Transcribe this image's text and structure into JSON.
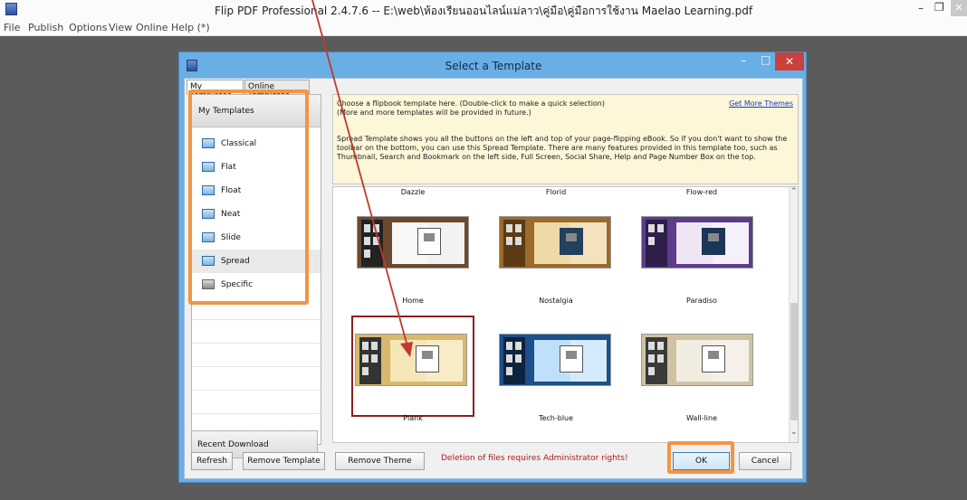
{
  "app": {
    "title": "Flip PDF Professional 2.4.7.6 -- E:\\web\\ห้องเรียนออนไลน์แม่ลาว\\คู่มือ\\คู่มือการใช้งาน Maelao Learning.pdf",
    "min": "–",
    "max": "❐",
    "close": "✕"
  },
  "menu": [
    "File",
    "Publish",
    "Options",
    "View",
    "Online",
    "Help (*)"
  ],
  "dialog": {
    "title": "Select a Template",
    "min": "–",
    "max": "□",
    "close": "✕",
    "tabs": [
      "My Templates",
      "Online Templates"
    ],
    "left_header": "My Templates",
    "templates": [
      {
        "label": "Classical",
        "icon": "template-blue-icon"
      },
      {
        "label": "Flat",
        "icon": "template-blue-icon"
      },
      {
        "label": "Float",
        "icon": "template-blue-icon"
      },
      {
        "label": "Neat",
        "icon": "template-blue-icon"
      },
      {
        "label": "Slide",
        "icon": "template-blue-icon"
      },
      {
        "label": "Spread",
        "icon": "template-blue-icon"
      },
      {
        "label": "Specific",
        "icon": "template-grey-icon"
      }
    ],
    "selected_template": "Spread",
    "recent": "Recent Download",
    "info": {
      "line1": "Choose a flipbook template here. (Double-click to make a quick selection)",
      "line2": "(More and more templates will be provided in future.)",
      "get_more": "Get More Themes",
      "desc1": "Spread Template shows you all the buttons on the left and top of your page-flipping eBook. So if you don't want to show the",
      "desc2": "toolbar on the bottom, you can use this Spread Template. There are many features provided in this template too, such as",
      "desc3": "Thumbnail, Search and Bookmark on the left side, Full Screen, Social Share, Help and Page Number Box on the top."
    },
    "grid_top_labels": [
      "Dazzle",
      "Florid",
      "Flow-red"
    ],
    "themes": [
      {
        "name": "Home",
        "colors": [
          "#6b4a2f",
          "#f6e9d4"
        ]
      },
      {
        "name": "Nostalgia",
        "colors": [
          "#9c6a2a",
          "#f0d9a8"
        ]
      },
      {
        "name": "Paradiso",
        "colors": [
          "#5d3c8c",
          "#efe6f5"
        ]
      },
      {
        "name": "Plank",
        "colors": [
          "#d8b86c",
          "#f5e6b8"
        ]
      },
      {
        "name": "Tech-blue",
        "colors": [
          "#1d4f8a",
          "#bfe0fb"
        ]
      },
      {
        "name": "Wall-line",
        "colors": [
          "#cfc2a3",
          "#f1ece0"
        ]
      }
    ],
    "selected_theme": "Plank",
    "buttons": {
      "refresh": "Refresh",
      "remove_template": "Remove Template",
      "remove_theme": "Remove Theme",
      "ok": "OK",
      "cancel": "Cancel"
    },
    "admin_note": "Deletion of files requires Administrator rights!"
  },
  "highlight_color": "#f29541",
  "arrow_color": "#c0392b"
}
